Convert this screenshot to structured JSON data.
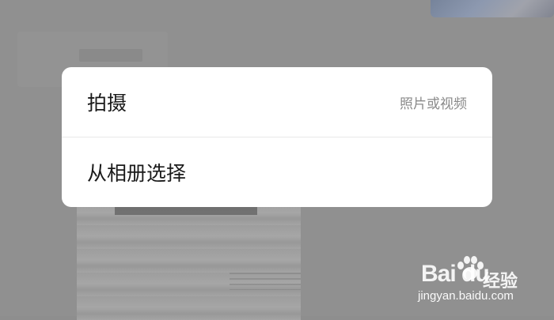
{
  "action_sheet": {
    "take_photo": {
      "label": "拍摄",
      "hint": "照片或视频"
    },
    "choose_from_album": {
      "label": "从相册选择"
    }
  },
  "watermark": {
    "brand": "Bai du",
    "title": "经验",
    "url": "jingyan.baidu.com"
  },
  "colors": {
    "overlay": "#8e8e8e",
    "sheet_background": "#ffffff",
    "primary_text": "#1a1a1a",
    "secondary_text": "#8a8a8a",
    "divider": "#e8e8e8"
  }
}
